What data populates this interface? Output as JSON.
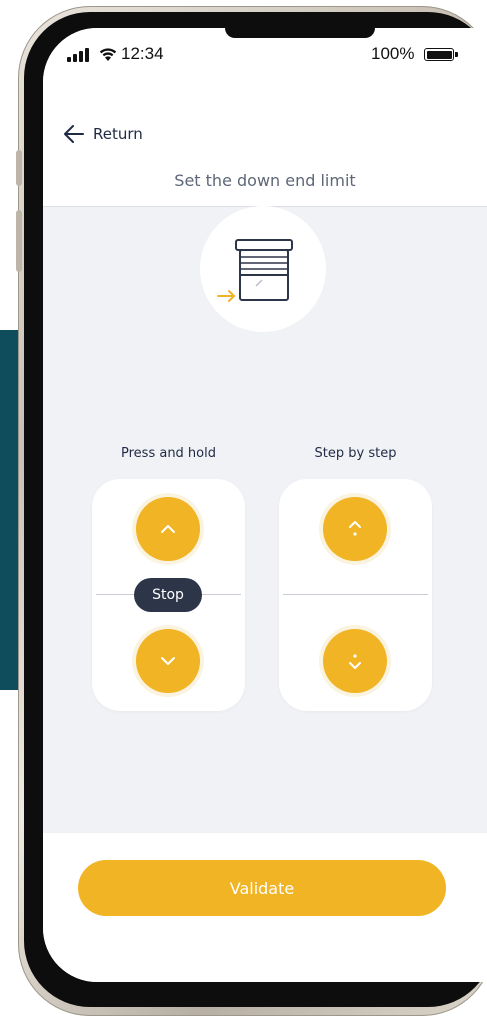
{
  "status_bar": {
    "time": "12:34",
    "battery_percent": "100%",
    "signal_icon": "cellular-signal-icon",
    "wifi_icon": "wifi-icon",
    "battery_icon": "battery-full-icon",
    "battery_level": 1.0
  },
  "header": {
    "back_label": "Return",
    "back_icon": "arrow-left-icon",
    "title": "Set the down end limit"
  },
  "illustration": {
    "icon": "roller-shutter-down-limit-icon"
  },
  "controls": {
    "press_and_hold": {
      "label": "Press and hold",
      "up_icon": "chevron-up-icon",
      "down_icon": "chevron-down-icon",
      "stop_label": "Stop"
    },
    "step_by_step": {
      "label": "Step by step",
      "up_icon": "step-up-icon",
      "down_icon": "step-down-icon"
    }
  },
  "footer": {
    "validate_label": "Validate"
  },
  "colors": {
    "accent": "#f0b424",
    "stop_button": "#2d3548",
    "screen_background": "#f1f2f6",
    "text_primary": "#1f2a44",
    "teal_panel": "#0f4c5c"
  }
}
